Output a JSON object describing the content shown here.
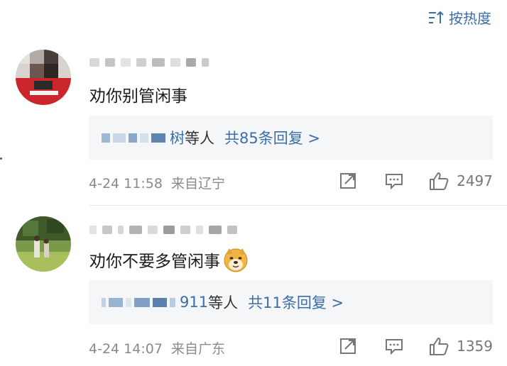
{
  "sort": {
    "label": "按热度",
    "icon": "sort-icon"
  },
  "comments": [
    {
      "text": "劝你别管闲事",
      "replies": {
        "name_tail": "树",
        "others": "等人",
        "count_label": "共85条回复 >"
      },
      "time": "4-24 11:58",
      "location": "来自辽宁",
      "likes": "2497"
    },
    {
      "text": "劝你不要多管闲事",
      "emoji": "doge-emoji",
      "replies": {
        "name_tail": "911",
        "others": "等人",
        "count_label": "共11条回复 >"
      },
      "time": "4-24 14:07",
      "location": "来自广东",
      "likes": "1359"
    }
  ],
  "colors": {
    "link": "#3b6ea8",
    "reply_bg": "#f5f6f8",
    "meta": "#8a8a8a"
  }
}
